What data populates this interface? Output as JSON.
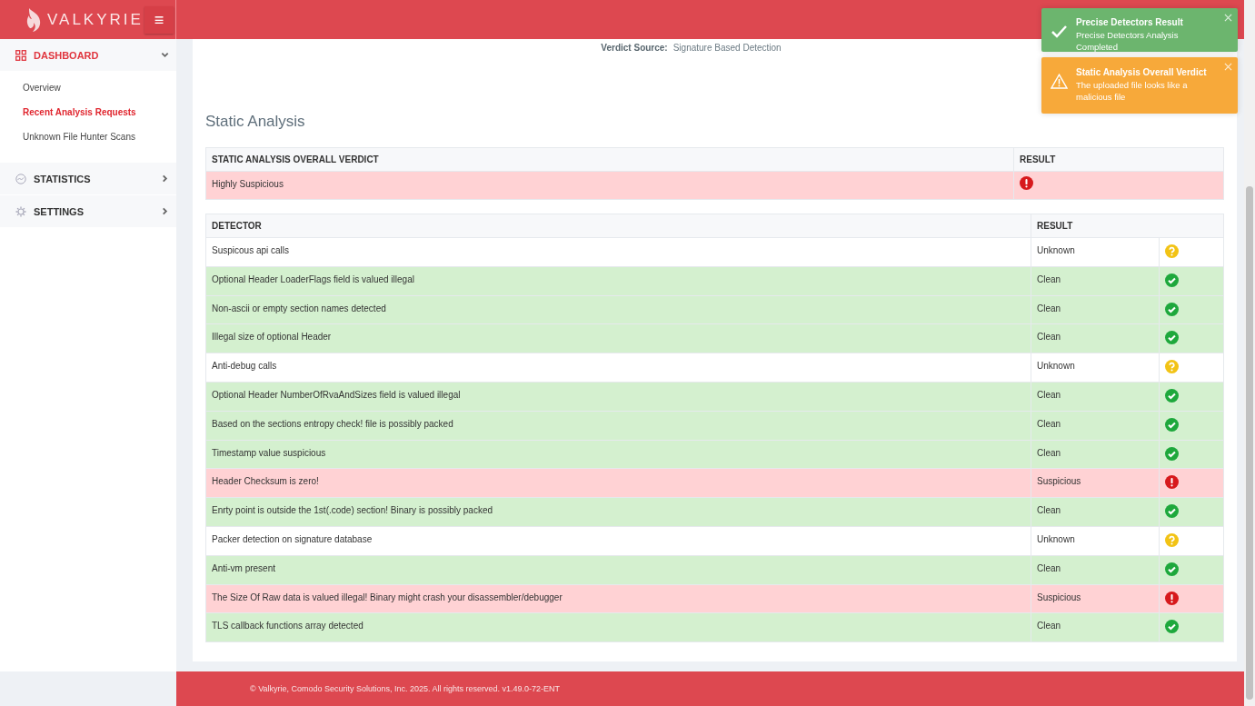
{
  "header": {
    "logo_text": "VALKYRIE",
    "menu_button": "≡"
  },
  "sidebar": {
    "items": [
      {
        "label": "DASHBOARD",
        "kind": "grid",
        "expanded": true,
        "children": [
          {
            "label": "Overview",
            "selected": false
          },
          {
            "label": "Recent Analysis Requests",
            "selected": true
          },
          {
            "label": "Unknown File Hunter Scans",
            "selected": false
          }
        ]
      },
      {
        "label": "STATISTICS",
        "kind": "gauge",
        "expanded": false
      },
      {
        "label": "SETTINGS",
        "kind": "gear",
        "expanded": false
      }
    ]
  },
  "verdict_source": {
    "label": "Verdict Source:",
    "value": "Signature Based Detection"
  },
  "section_title": "Static Analysis",
  "overall_table": {
    "columns": [
      "STATIC ANALYSIS OVERALL VERDICT",
      "RESULT"
    ],
    "rows": [
      {
        "verdict": "Highly Suspicious",
        "kind": "suspicious"
      }
    ]
  },
  "detector_table": {
    "columns": [
      "DETECTOR",
      "RESULT"
    ],
    "rows": [
      {
        "detector": "Suspicous api calls",
        "result": "Unknown",
        "kind": "unknown"
      },
      {
        "detector": "Optional Header LoaderFlags field is valued illegal",
        "result": "Clean",
        "kind": "clean"
      },
      {
        "detector": "Non-ascii or empty section names detected",
        "result": "Clean",
        "kind": "clean"
      },
      {
        "detector": "Illegal size of optional Header",
        "result": "Clean",
        "kind": "clean"
      },
      {
        "detector": "Anti-debug calls",
        "result": "Unknown",
        "kind": "unknown"
      },
      {
        "detector": "Optional Header NumberOfRvaAndSizes field is valued illegal",
        "result": "Clean",
        "kind": "clean"
      },
      {
        "detector": "Based on the sections entropy check! file is possibly packed",
        "result": "Clean",
        "kind": "clean"
      },
      {
        "detector": "Timestamp value suspicious",
        "result": "Clean",
        "kind": "clean"
      },
      {
        "detector": "Header Checksum is zero!",
        "result": "Suspicious",
        "kind": "suspicious"
      },
      {
        "detector": "Enrty point is outside the 1st(.code) section! Binary is possibly packed",
        "result": "Clean",
        "kind": "clean"
      },
      {
        "detector": "Packer detection on signature database",
        "result": "Unknown",
        "kind": "unknown"
      },
      {
        "detector": "Anti-vm present",
        "result": "Clean",
        "kind": "clean"
      },
      {
        "detector": "The Size Of Raw data is valued illegal! Binary might crash your disassembler/debugger",
        "result": "Suspicious",
        "kind": "suspicious"
      },
      {
        "detector": "TLS callback functions array detected",
        "result": "Clean",
        "kind": "clean"
      }
    ]
  },
  "toasts": [
    {
      "kind": "success",
      "title": "Precise Detectors Result",
      "message": "Precise Detectors Analysis Completed"
    },
    {
      "kind": "warning",
      "title": "Static Analysis Overall Verdict",
      "message": "The uploaded file looks like a malicious file"
    }
  ],
  "footer": "© Valkyrie, Comodo Security Solutions, Inc. 2025. All rights reserved. v1.49.0-72-ENT"
}
